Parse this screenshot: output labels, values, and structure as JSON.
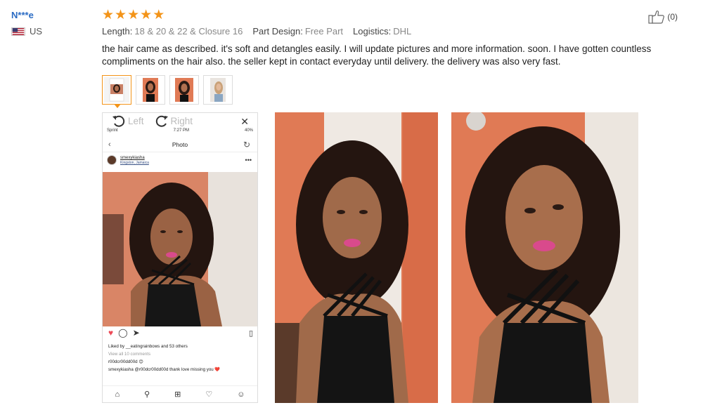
{
  "reviewer": {
    "name": "N***e",
    "country": "US"
  },
  "rating": {
    "stars": 5
  },
  "attributes": [
    {
      "key": "Length:",
      "value": "18 & 20 & 22 & Closure 16"
    },
    {
      "key": "Part Design:",
      "value": "Free Part"
    },
    {
      "key": "Logistics:",
      "value": "DHL"
    }
  ],
  "review_text": "the hair came as described. it's soft and detangles easily. I will update pictures and more information. soon. I have gotten countless compliments on the hair also. the seller kept in contact everyday until delivery. the delivery was also very fast.",
  "helpful": {
    "count": "(0)"
  },
  "viewer": {
    "rotate_left": "Left",
    "rotate_right": "Right",
    "close": "✕",
    "phone": {
      "carrier": "Sprint",
      "time": "7:27 PM",
      "battery": "40%",
      "header": "Photo",
      "username": "smexykiasha",
      "location": "Kingston, Jamaica",
      "liked_by": "Liked by __eatingrainbows and 53 others",
      "view_comments": "View all 10 comments",
      "comment1": "r00dcr00dd00d 😊",
      "comment2": "smexykiasha @r00dcr00dd00d thank love missing you ❤️"
    }
  },
  "colors": {
    "accent": "#f39419",
    "name": "#2b6cc4",
    "wall": "#e07a55"
  }
}
